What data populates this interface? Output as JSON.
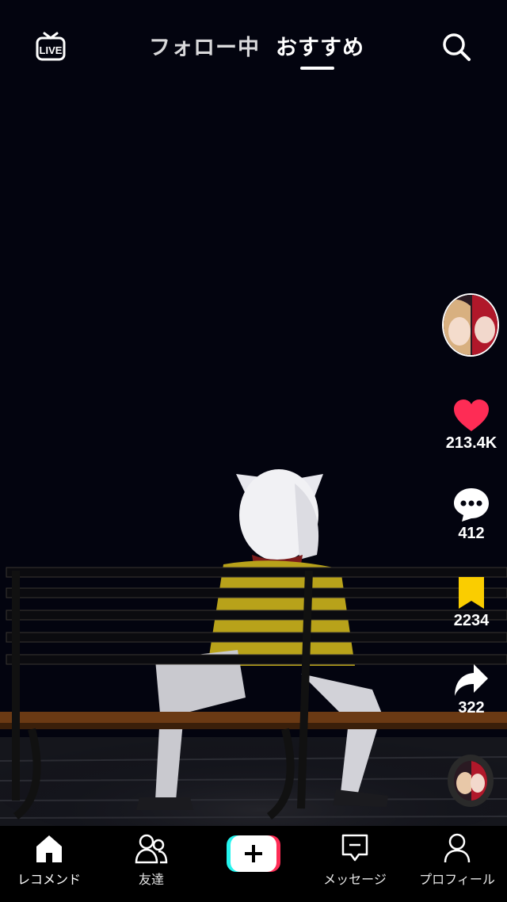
{
  "top": {
    "live_label": "LIVE",
    "tabs": [
      {
        "label": "フォロー中",
        "active": false
      },
      {
        "label": "おすすめ",
        "active": true
      }
    ]
  },
  "rail": {
    "likes": "213.4K",
    "comments": "412",
    "saves": "2234",
    "shares": "322"
  },
  "nav": [
    {
      "label": "レコメンド",
      "active": true
    },
    {
      "label": "友達",
      "active": false
    },
    {
      "label": "",
      "active": false
    },
    {
      "label": "メッセージ",
      "active": false
    },
    {
      "label": "プロフィール",
      "active": false
    }
  ],
  "colors": {
    "like": "#fe2c55",
    "save": "#facd00",
    "create_left": "#25f4ee",
    "create_right": "#fe2c55"
  }
}
